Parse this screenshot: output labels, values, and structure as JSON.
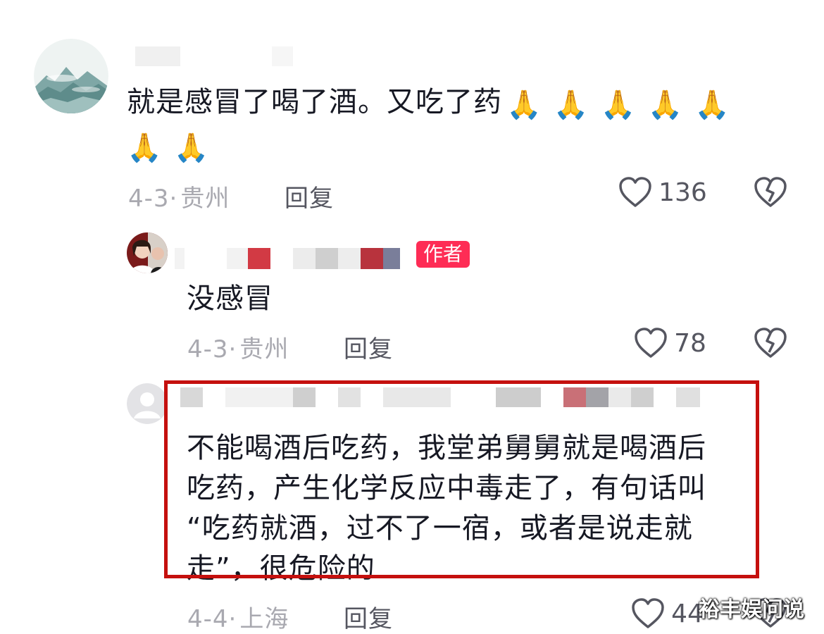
{
  "comments": [
    {
      "text": "就是感冒了喝了酒。又吃了药",
      "emoji": [
        "🙏",
        "🙏",
        "🙏",
        "🙏",
        "🙏",
        "🙏",
        "🙏"
      ],
      "date": "4-3",
      "location": "贵州",
      "reply_label": "回复",
      "likes": "136"
    },
    {
      "badge": "作者",
      "text": "没感冒",
      "date": "4-3",
      "location": "贵州",
      "reply_label": "回复",
      "likes": "78"
    },
    {
      "text_lines": [
        "不能喝酒后吃药，我堂弟舅舅就是喝酒后",
        "吃药，产生化学反应中毒走了，有句话叫",
        "“吃药就酒，过不了一宿，或者是说走就",
        "走”，很危险的"
      ],
      "date": "4-4",
      "location": "上海",
      "reply_label": "回复",
      "likes": "44"
    }
  ],
  "separator": "·",
  "watermark": "裕丰娱问说",
  "icons": {
    "like": "heart-outline-icon",
    "dislike": "broken-heart-icon"
  },
  "colors": {
    "badge": "#fe2c55",
    "highlight": "#c5100e",
    "meta": "#a9a9b0"
  }
}
